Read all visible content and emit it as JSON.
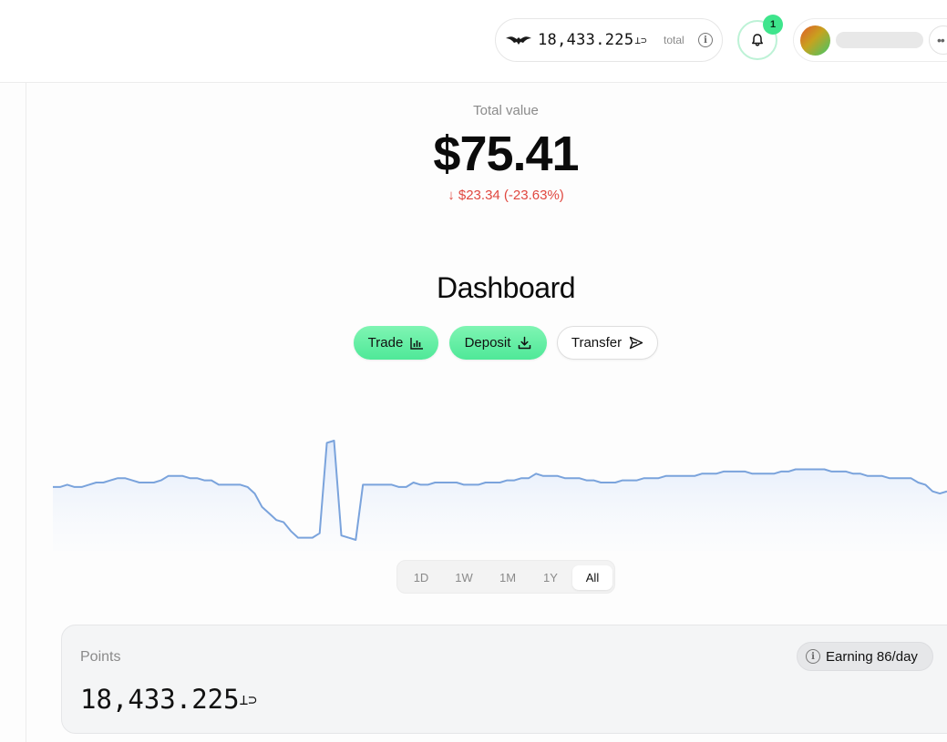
{
  "header": {
    "points_value": "18,433.225",
    "points_suffix": "⊥⊃",
    "total_label": "total",
    "notification_count": "1"
  },
  "summary": {
    "total_label": "Total value",
    "total_value": "$75.41",
    "change_arrow": "↓",
    "change_text": "$23.34 (-23.63%)",
    "change_color": "#e0473f"
  },
  "dashboard": {
    "title": "Dashboard",
    "trade_label": "Trade",
    "deposit_label": "Deposit",
    "transfer_label": "Transfer"
  },
  "chart_data": {
    "type": "area",
    "color": "#7aa3dc",
    "grid": false,
    "values": [
      75,
      75,
      76,
      75,
      75,
      76,
      77,
      77,
      78,
      79,
      79,
      78,
      77,
      77,
      77,
      78,
      80,
      80,
      80,
      79,
      79,
      78,
      78,
      76,
      76,
      76,
      76,
      75,
      72,
      66,
      63,
      60,
      59,
      55,
      52,
      52,
      52,
      54,
      95,
      96,
      53,
      52,
      51,
      76,
      76,
      76,
      76,
      76,
      75,
      75,
      77,
      76,
      76,
      77,
      77,
      77,
      77,
      76,
      76,
      76,
      77,
      77,
      77,
      78,
      78,
      79,
      79,
      81,
      80,
      80,
      80,
      79,
      79,
      79,
      78,
      78,
      77,
      77,
      77,
      78,
      78,
      78,
      79,
      79,
      79,
      80,
      80,
      80,
      80,
      80,
      81,
      81,
      81,
      82,
      82,
      82,
      82,
      81,
      81,
      81,
      81,
      82,
      82,
      83,
      83,
      83,
      83,
      83,
      82,
      82,
      82,
      81,
      81,
      80,
      80,
      80,
      79,
      79,
      79,
      79,
      77,
      76,
      73,
      72,
      73
    ],
    "ranges": [
      "1D",
      "1W",
      "1M",
      "1Y",
      "All"
    ],
    "selected_range": "All"
  },
  "points_card": {
    "label": "Points",
    "value": "18,433.225",
    "suffix": "⊥⊃",
    "earning_text": "Earning 86/day"
  }
}
